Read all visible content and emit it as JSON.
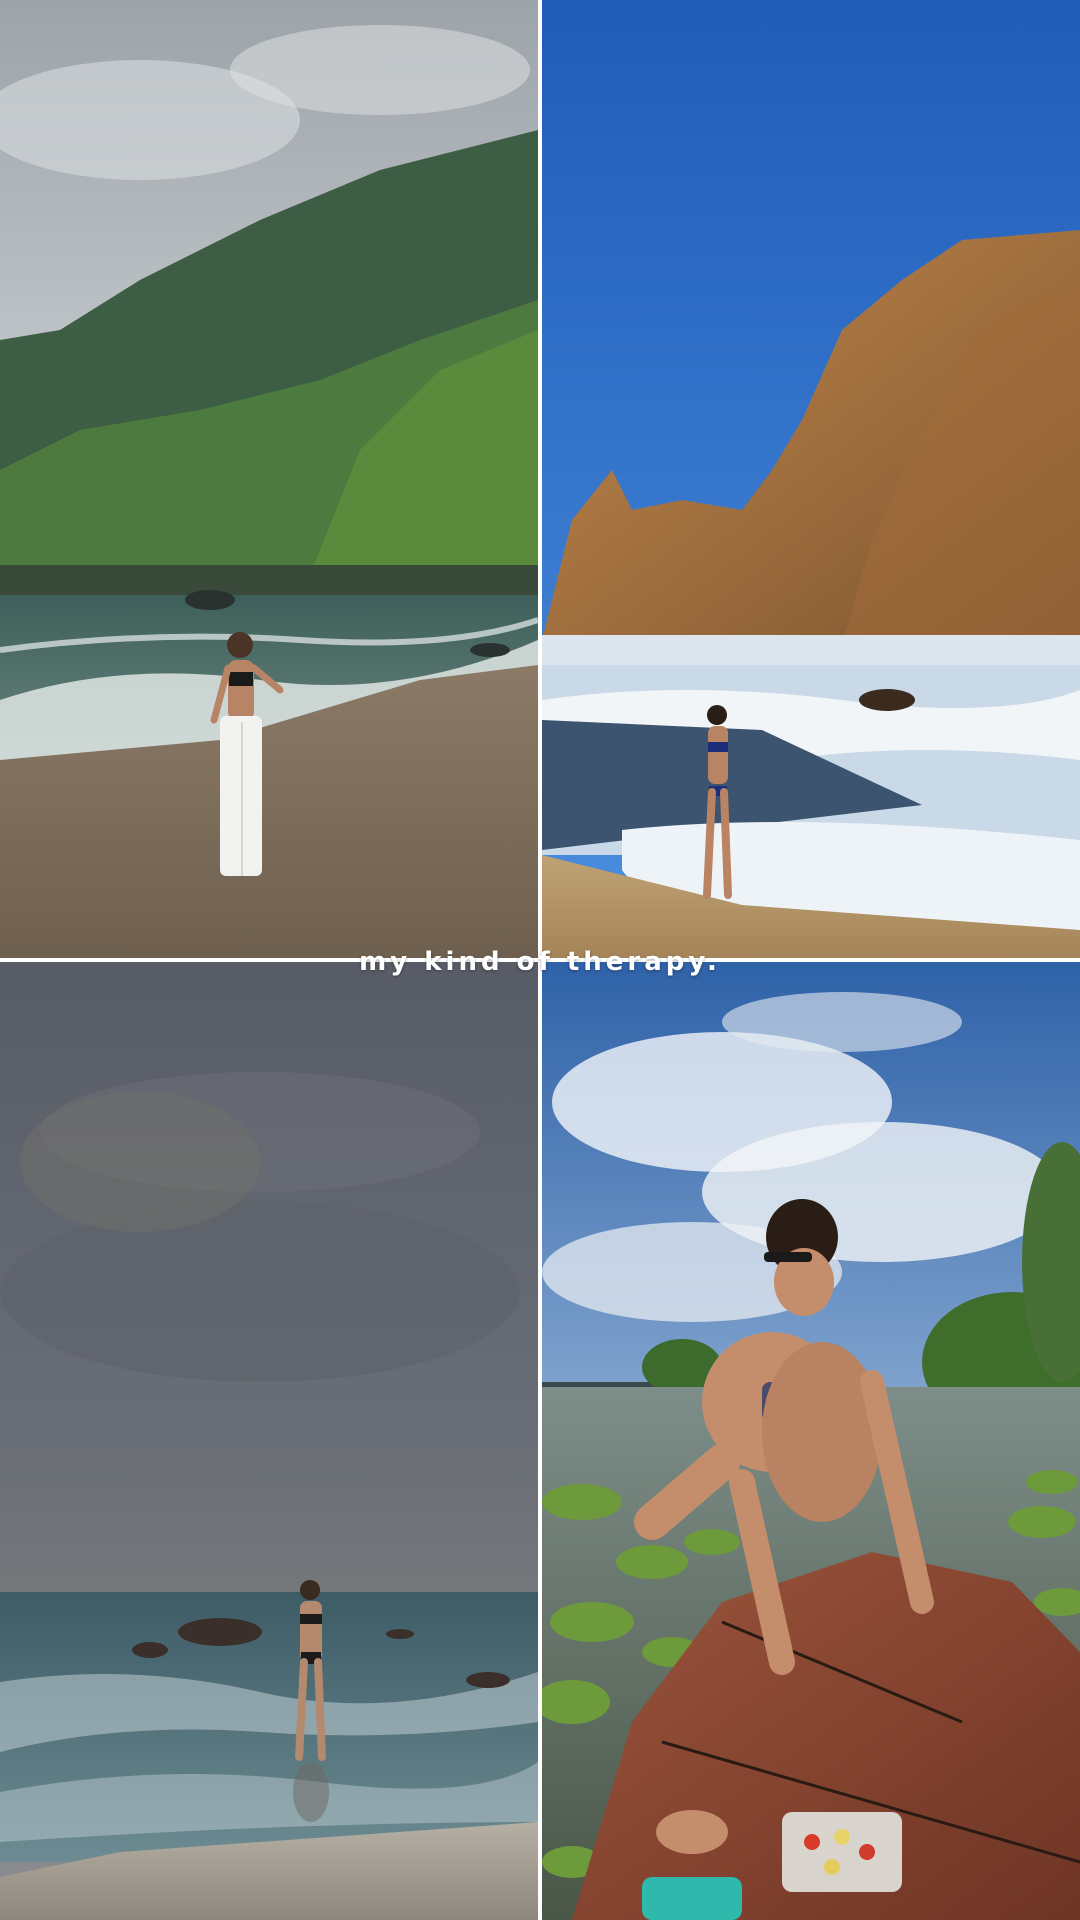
{
  "caption": "my kind of therapy.",
  "grid": {
    "photos": [
      {
        "name": "beach-mountains-photo",
        "palette": {
          "sky": "#b9bfc3",
          "mountain": "#3f6b45",
          "sea": "#4f6e6a",
          "sand": "#8a7a68"
        }
      },
      {
        "name": "rock-cliff-beach-photo",
        "palette": {
          "sky": "#2e6cc4",
          "rock": "#a9733f",
          "surf": "#e8eef2",
          "sand": "#b69a6e"
        }
      },
      {
        "name": "stormy-sea-photo",
        "palette": {
          "sky": "#5f636d",
          "sea": "#4c6f78",
          "pier": "#a49e94"
        }
      },
      {
        "name": "paddleboard-lake-photo",
        "palette": {
          "sky": "#8fb1d9",
          "water": "#6e7e6a",
          "lilypads": "#6d9a3a",
          "board": "#8a4a36"
        }
      }
    ]
  }
}
